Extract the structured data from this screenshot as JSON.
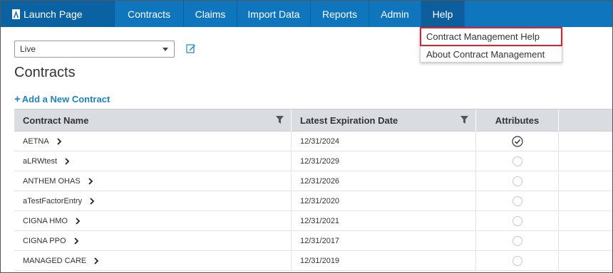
{
  "nav": {
    "brand_label": "Launch Page",
    "items": [
      {
        "label": "Contracts"
      },
      {
        "label": "Claims"
      },
      {
        "label": "Import Data"
      },
      {
        "label": "Reports"
      },
      {
        "label": "Admin"
      },
      {
        "label": "Help"
      }
    ]
  },
  "help_menu": {
    "items": [
      {
        "label": "Contract Management Help"
      },
      {
        "label": "About Contract Management"
      }
    ]
  },
  "filter_select": {
    "value": "Live"
  },
  "page": {
    "title": "Contracts",
    "add_link": "Add a New Contract",
    "add_icon": "+"
  },
  "table": {
    "columns": [
      "Contract Name",
      "Latest Expiration Date",
      "Attributes"
    ],
    "rows": [
      {
        "name": "AETNA",
        "date": "12/31/2024",
        "attribute_checked": true
      },
      {
        "name": "aLRWtest",
        "date": "12/31/2029",
        "attribute_checked": false
      },
      {
        "name": "ANTHEM OHAS",
        "date": "12/31/2026",
        "attribute_checked": false
      },
      {
        "name": "aTestFactorEntry",
        "date": "12/31/2020",
        "attribute_checked": false
      },
      {
        "name": "CIGNA HMO",
        "date": "12/31/2021",
        "attribute_checked": false
      },
      {
        "name": "CIGNA PPO",
        "date": "12/31/2017",
        "attribute_checked": false
      },
      {
        "name": "MANAGED CARE",
        "date": "12/31/2019",
        "attribute_checked": false
      }
    ]
  },
  "colors": {
    "nav_bg": "#0f75bd",
    "accent_link": "#1b84c5",
    "highlight_outline": "#e0202a"
  }
}
